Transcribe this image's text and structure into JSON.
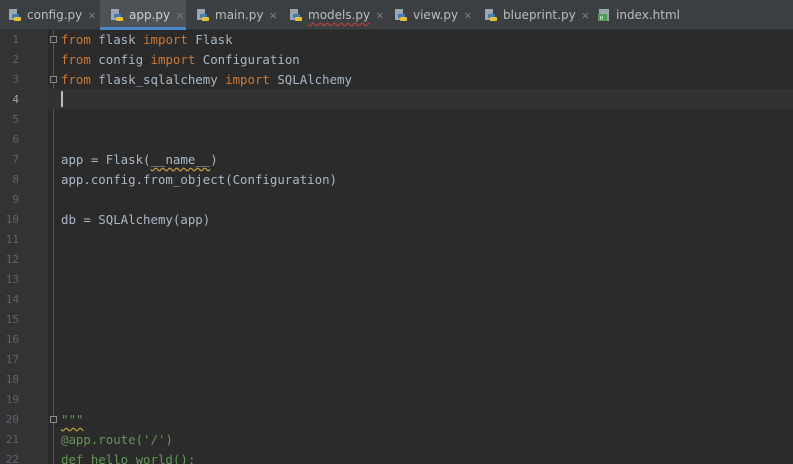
{
  "tabs": [
    {
      "label": "config.py",
      "icon": "python-file-icon",
      "close": "×",
      "active": false
    },
    {
      "label": "app.py",
      "icon": "python-file-icon",
      "close": "×",
      "active": true
    },
    {
      "label": "main.py",
      "icon": "python-file-icon",
      "close": "×",
      "active": false
    },
    {
      "label": "models.py",
      "icon": "python-file-icon",
      "close": "×",
      "active": false
    },
    {
      "label": "view.py",
      "icon": "python-file-icon",
      "close": "×",
      "active": false
    },
    {
      "label": "blueprint.py",
      "icon": "python-file-icon",
      "close": "×",
      "active": false
    },
    {
      "label": "index.html",
      "icon": "html-file-icon",
      "close": "",
      "active": false
    }
  ],
  "editor": {
    "current_line": "4",
    "line_numbers": [
      "1",
      "2",
      "3",
      "4",
      "5",
      "6",
      "7",
      "8",
      "9",
      "10",
      "11",
      "12",
      "13",
      "14",
      "15",
      "16",
      "17",
      "18",
      "19",
      "20",
      "21",
      "22"
    ],
    "lines": {
      "l1": {
        "kw1": "from",
        "mod": " flask ",
        "kw2": "import",
        "name": " Flask"
      },
      "l2": {
        "kw1": "from",
        "mod": " config ",
        "kw2": "import",
        "name": " Configuration"
      },
      "l3": {
        "kw1": "from",
        "mod": " flask_sqlalchemy ",
        "kw2": "import",
        "name": " SQLAlchemy"
      },
      "l7": {
        "pre": "app = Flask(",
        "arg": "__name__",
        "post": ")"
      },
      "l8": {
        "text": "app.config.from_object(Configuration)"
      },
      "l10": {
        "text": "db = SQLAlchemy(app)"
      },
      "l20": {
        "text": "\"\"\""
      },
      "l21": {
        "text": "@app.route('/')"
      },
      "l22": {
        "text": "def hello_world():"
      }
    }
  },
  "colors": {
    "background": "#2b2b2b",
    "gutter": "#313335",
    "tabbar": "#3c3f41",
    "active_tab_underline": "#4a88c7",
    "keyword": "#cc7832",
    "docstring": "#629755",
    "text": "#a9b7c6"
  }
}
